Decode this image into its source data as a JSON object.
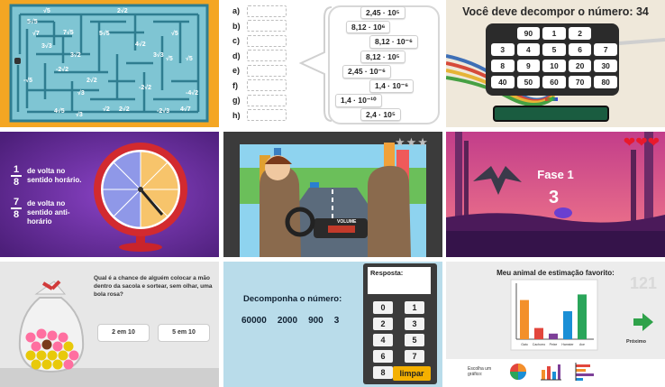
{
  "tiles": {
    "maze": {
      "labels": [
        "√5",
        "5√5",
        "2√2",
        "3√3",
        "√7",
        "√5",
        "7√5",
        "3√2",
        "5√5",
        "4√2",
        "-2√2",
        "√5",
        "2√2",
        "-√5",
        "3√3",
        "√5",
        "-2√2",
        "-4√2",
        "√3",
        "√3",
        "√2",
        "2√2",
        "4√5",
        "-2√3",
        "4√7"
      ]
    },
    "exercise": {
      "letters": [
        "a)",
        "b)",
        "c)",
        "d)",
        "e)",
        "f)",
        "g)",
        "h)"
      ],
      "values": [
        "2,45 · 10⁵",
        "8,12 · 10⁶",
        "8,12 · 10⁻⁶",
        "8,12 · 10⁵",
        "2,45 · 10⁻⁶",
        "1,4 · 10⁻⁶",
        "1,4 · 10⁻¹⁰",
        "2,4 · 10⁵"
      ]
    },
    "decompose": {
      "title": "Você deve decompor o número: 34",
      "keys": [
        "90",
        "1",
        "2",
        "3",
        "4",
        "5",
        "6",
        "7",
        "8",
        "9",
        "10",
        "20",
        "30",
        "40",
        "50",
        "60",
        "70",
        "80"
      ]
    },
    "spinner": {
      "frac1_num": "1",
      "frac1_den": "8",
      "frac1_label": "de volta no sentido horário.",
      "frac2_num": "7",
      "frac2_den": "8",
      "frac2_label": "de volta no sentido anti-horário"
    },
    "driving": {
      "volume_label": "VOLUME"
    },
    "bat": {
      "stage": "Fase 1",
      "count": "3"
    },
    "probability": {
      "question": "Qual é a chance de alguém colocar a mão dentro da sacola e sortear, sem olhar, uma bola rosa?",
      "option1": "2 em 10",
      "option2": "5 em 10"
    },
    "keypad": {
      "answer_label": "Resposta:",
      "instruction": "Decomponha o número:",
      "numbers": [
        "60000",
        "2000",
        "900",
        "3"
      ],
      "keys": [
        "0",
        "1",
        "2",
        "3",
        "4",
        "5",
        "6",
        "7",
        "8",
        "9"
      ],
      "clear": "limpar"
    },
    "barchart": {
      "title": "Meu animal de estimação favorito:",
      "next": "Próximo",
      "choose": "Escolha um gráfico:",
      "colors": {
        "orange": "#f3902b",
        "red": "#e2463c",
        "purple": "#7d3f98",
        "blue": "#1a8fd6",
        "green": "#2aa55a"
      }
    }
  },
  "chart_data": {
    "type": "bar",
    "title": "Meu animal de estimação favorito:",
    "categories": [
      "Gato",
      "Cachorro",
      "Peixe",
      "Hamster",
      "Ave"
    ],
    "values": [
      7,
      2,
      1,
      5,
      8
    ],
    "ylim": [
      0,
      10
    ]
  }
}
